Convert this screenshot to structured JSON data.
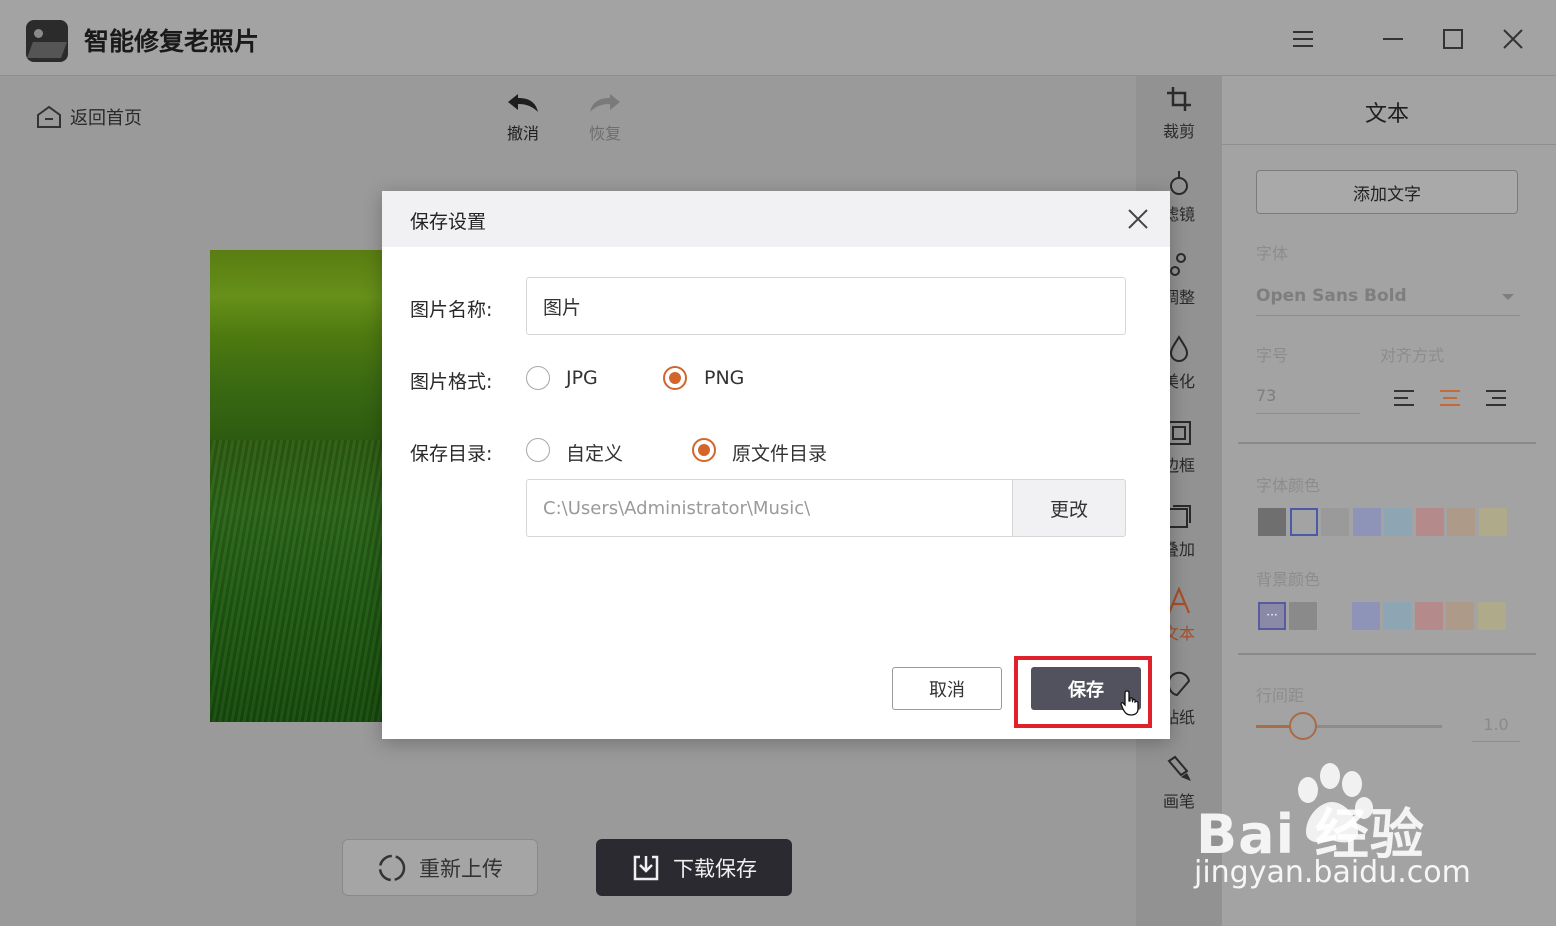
{
  "app": {
    "title": "智能修复老照片"
  },
  "toolbar": {
    "back_home": "返回首页",
    "undo": "撤消",
    "redo": "恢复"
  },
  "bottom": {
    "reupload": "重新上传",
    "download": "下载保存"
  },
  "tools": [
    {
      "label": "裁剪",
      "icon": "crop-icon"
    },
    {
      "label": "滤镜",
      "icon": "filter-icon"
    },
    {
      "label": "调整",
      "icon": "adjust-icon"
    },
    {
      "label": "美化",
      "icon": "beautify-icon"
    },
    {
      "label": "边框",
      "icon": "border-icon"
    },
    {
      "label": "叠加",
      "icon": "overlay-icon"
    },
    {
      "label": "文本",
      "icon": "text-icon",
      "active": true
    },
    {
      "label": "贴纸",
      "icon": "sticker-icon"
    },
    {
      "label": "画笔",
      "icon": "brush-icon"
    }
  ],
  "panel": {
    "title": "文本",
    "add_text": "添加文字",
    "font_label": "字体",
    "font_value": "Open Sans Bold",
    "size_label": "字号",
    "size_value": "73",
    "align_label": "对齐方式",
    "align_selected": "center",
    "font_color_label": "字体颜色",
    "bg_color_label": "背景颜色",
    "line_spacing_label": "行间距",
    "line_spacing_value": "1.0",
    "line_spacing_level": 0.1,
    "font_colors": [
      "#6f6f6f",
      "#a3a3a3",
      "#9a9a9a",
      "#8e94b8",
      "#8ea6b4",
      "#b48a8a",
      "#ae9a88",
      "#aeaa8a"
    ],
    "bg_colors": [
      "#8a8aa6",
      "#8a8a8a",
      "#8e94b8",
      "#8ea6b4",
      "#b48a8a",
      "#ae9a88",
      "#aeaa8a"
    ]
  },
  "dialog": {
    "title": "保存设置",
    "name_label": "图片名称:",
    "name_value": "图片",
    "format_label": "图片格式:",
    "format_options": [
      "JPG",
      "PNG"
    ],
    "format_selected": "PNG",
    "dir_label": "保存目录:",
    "dir_options": [
      "自定义",
      "原文件目录"
    ],
    "dir_selected": "原文件目录",
    "dir_path": "C:\\Users\\Administrator\\Music\\",
    "change_label": "更改",
    "cancel_label": "取消",
    "save_label": "保存"
  },
  "watermark": {
    "brand": "Bai  经验",
    "url": "jingyan.baidu.com"
  },
  "colors": {
    "accent": "#d2642c",
    "highlight": "#e0202a",
    "save_button": "#52525e",
    "download_button": "#2a2a30"
  }
}
